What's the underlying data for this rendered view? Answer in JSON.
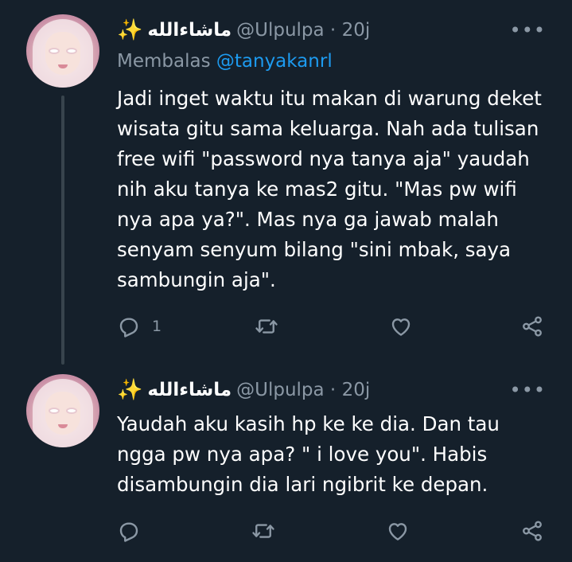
{
  "thread": [
    {
      "display_name": "ماشاءالله",
      "sparkle": "✨",
      "handle": "@Ulpulpa",
      "time": "20j",
      "more": "•••",
      "reply_label": "Membalas",
      "reply_mention": "@tanyakanrl",
      "lines": [
        "Jadi inget waktu itu makan di warung deket",
        "wisata gitu sama keluarga. Nah ada tulisan",
        "free wifi \"password nya tanya aja\" yaudah",
        "nih aku tanya ke mas2 gitu. \"Mas pw wifi",
        "nya apa ya?\". Mas nya ga jawab malah",
        "senyam senyum bilang \"sini mbak, saya",
        "sambungin aja\"."
      ],
      "reply_count": "1"
    },
    {
      "display_name": "ماشاءالله",
      "sparkle": "✨",
      "handle": "@Ulpulpa",
      "time": "20j",
      "more": "•••",
      "lines": [
        "Yaudah aku kasih hp ke ke dia. Dan tau",
        "ngga pw nya apa? \" i love you\". Habis",
        "disambungin dia lari ngibrit ke depan."
      ]
    }
  ],
  "icons": [
    "reply-icon",
    "retweet-icon",
    "like-icon",
    "share-icon"
  ],
  "colors": {
    "background": "#15202b",
    "muted": "#8b98a5",
    "accent": "#1d9bf0",
    "thread_line": "#38444d"
  }
}
